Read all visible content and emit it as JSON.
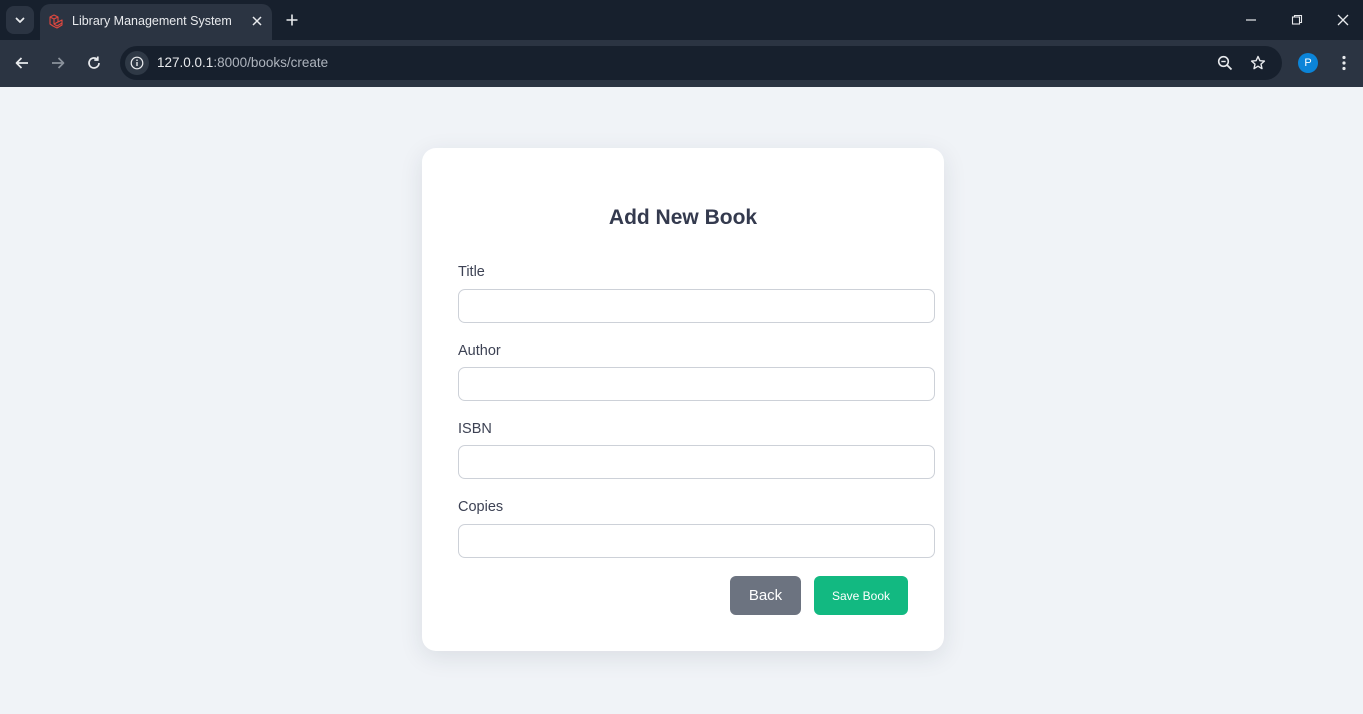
{
  "browser": {
    "tab_title": "Library Management System",
    "url_host": "127.0.0.1",
    "url_path": ":8000/books/create",
    "profile_initial": "P",
    "avatar_color": "#0b84d8"
  },
  "form": {
    "heading": "Add New Book",
    "fields": [
      {
        "label": "Title",
        "value": ""
      },
      {
        "label": "Author",
        "value": ""
      },
      {
        "label": "ISBN",
        "value": ""
      },
      {
        "label": "Copies",
        "value": ""
      }
    ],
    "back_label": "Back",
    "save_label": "Save Book"
  },
  "colors": {
    "page_background": "#f0f3f7",
    "save_button": "#12b981",
    "back_button": "#6c7380",
    "heading_text": "#343a4e"
  }
}
